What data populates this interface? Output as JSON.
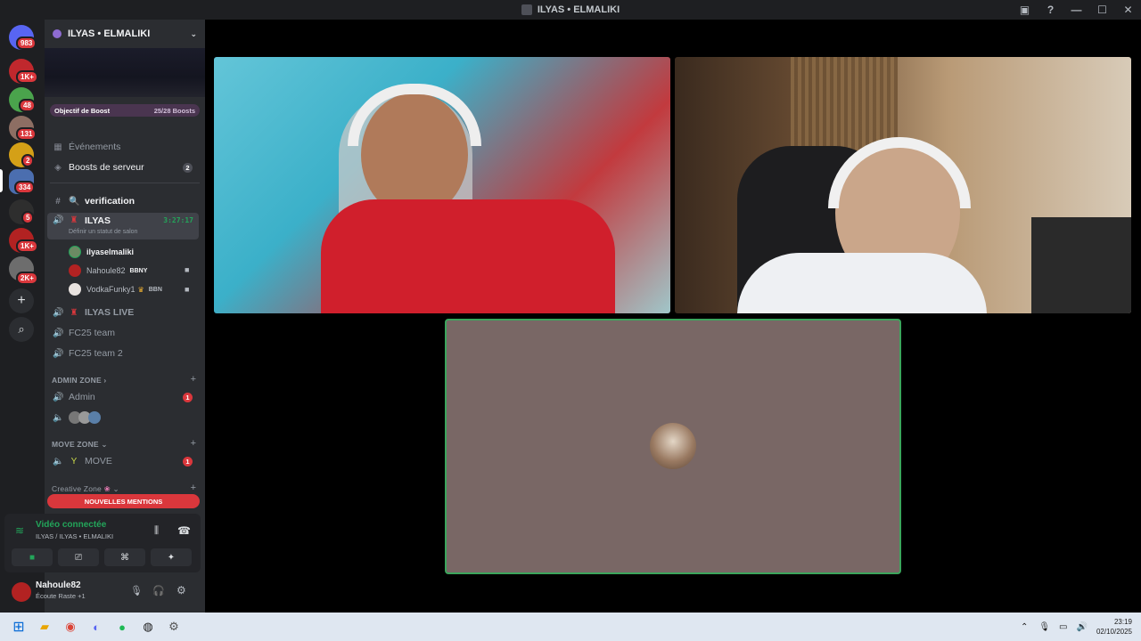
{
  "window": {
    "title": "ILYAS • ELMALIKI",
    "controls": {
      "minimize": "—",
      "maximize": "☐",
      "close": "✕"
    }
  },
  "rail": {
    "servers": [
      {
        "name": "discord-home",
        "badge": "983",
        "color": "#5865f2"
      },
      {
        "name": "server-1",
        "badge": "1K+",
        "color": "#c0282d"
      },
      {
        "name": "server-2",
        "badge": "48",
        "color": "#4aa34c"
      },
      {
        "name": "server-3",
        "badge": "131",
        "color": "#8d6e63"
      },
      {
        "name": "server-4",
        "badge": "2",
        "color": "#d4a017"
      },
      {
        "name": "server-5",
        "badge": "334",
        "color": "#4b6eaf"
      },
      {
        "name": "server-6",
        "badge": "5",
        "color": "#2e2e2e"
      },
      {
        "name": "server-7",
        "badge": "1K+",
        "color": "#b22222"
      },
      {
        "name": "server-8",
        "badge": "2K+",
        "color": "#6d6d6d"
      }
    ],
    "add_server_glyph": "+",
    "explore_glyph": "⌕"
  },
  "panel": {
    "guild_name": "ILYAS • ELMALIKI",
    "boost": {
      "label": "Objectif de Boost",
      "progress": "25/28 Boosts"
    },
    "events_label": "Événements",
    "boosts_label": "Boosts de serveur",
    "boosts_count": "2",
    "channels": {
      "verification": "verification",
      "ilyas": "ILYAS",
      "ilyas_timer": "3:27:17",
      "ilyas_status": "Définir un statut de salon",
      "ilyas_live": "ILYAS LIVE",
      "fc25": "FC25 team",
      "fc25_2": "FC25 team 2",
      "admin": "Admin",
      "admin_badge": "1",
      "move": "MOVE",
      "move_badge": "1"
    },
    "voice_users": [
      {
        "name": "ilyaselmaliki",
        "tag": ""
      },
      {
        "name": "Nahoule82",
        "tag": "BBNY"
      },
      {
        "name": "VodkaFunky1",
        "tag": "BBN"
      }
    ],
    "categories": {
      "admin_zone": "ADMIN ZONE",
      "move_zone": "MOVE ZONE",
      "creative_zone": "Creative Zone"
    },
    "new_mentions": "NOUVELLES MENTIONS"
  },
  "voice_panel": {
    "title": "Vidéo connectée",
    "subtitle": "ILYAS / ILYAS • ELMALIKI"
  },
  "user": {
    "name": "Nahoule82",
    "status": "Écoute Raste +1"
  },
  "taskbar": {
    "time": "23:19",
    "date": "02/10/2025"
  }
}
